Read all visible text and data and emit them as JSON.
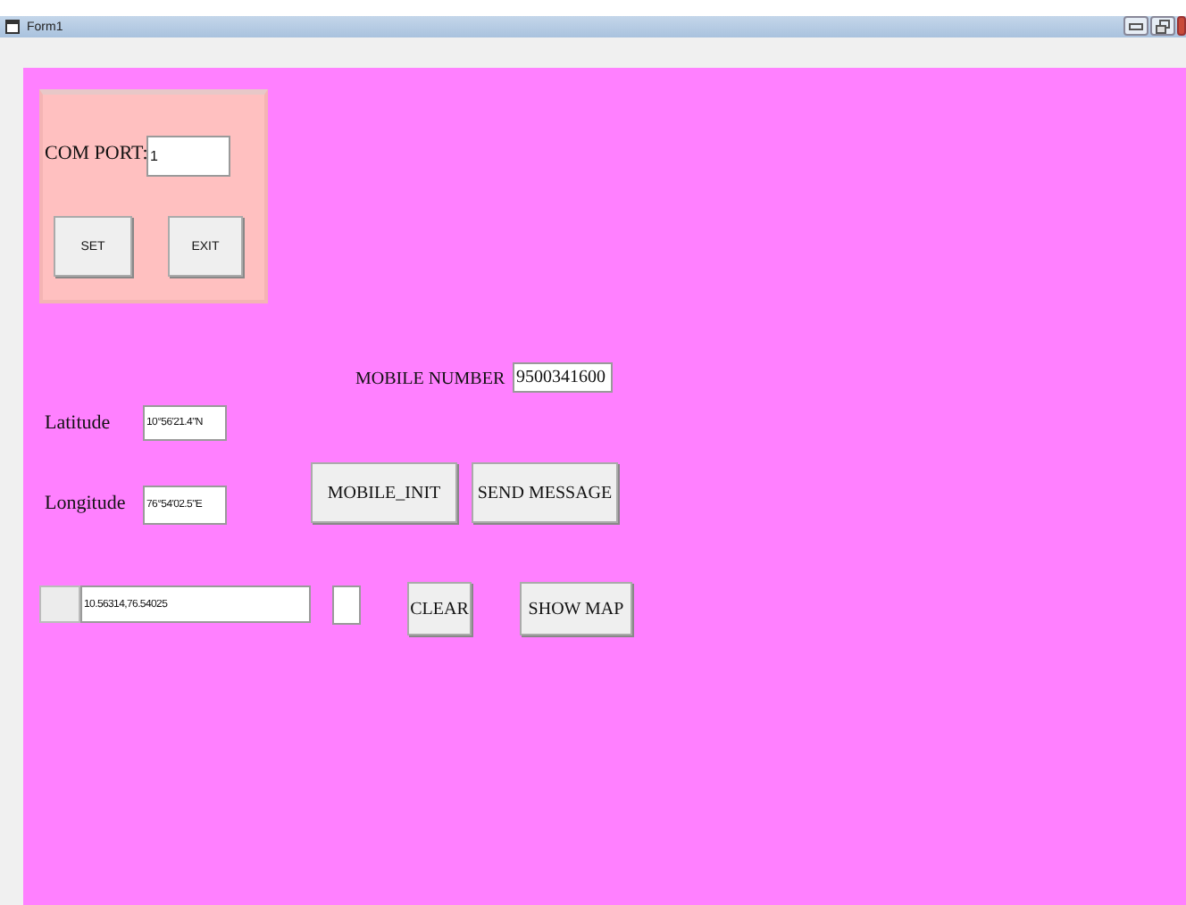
{
  "window": {
    "title": "Form1"
  },
  "com_panel": {
    "label": "COM PORT:",
    "value": "1",
    "buttons": [
      "SET",
      "EXIT"
    ]
  },
  "mobile": {
    "label": "MOBILE NUMBER",
    "value": "9500341600"
  },
  "latitude": {
    "label": "Latitude",
    "value": "10°56'21.4\"N"
  },
  "longitude": {
    "label": "Longitude",
    "value": "76°54'02.5\"E"
  },
  "action_buttons": [
    "MOBILE_INIT",
    "SEND MESSAGE"
  ],
  "coordinates": {
    "value": "10.56314,76.54025"
  },
  "bottom_buttons": [
    "CLEAR",
    "SHOW MAP"
  ]
}
